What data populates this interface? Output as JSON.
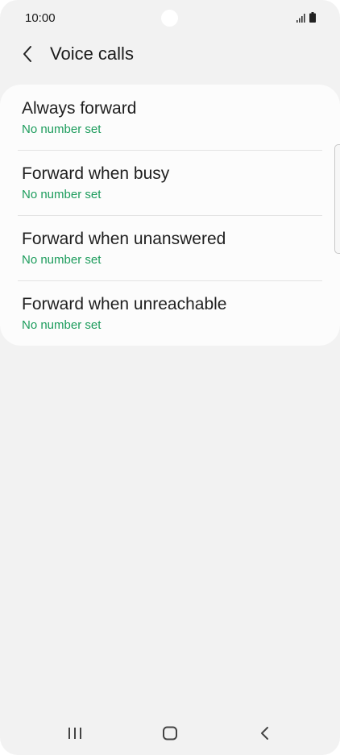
{
  "status_bar": {
    "time": "10:00",
    "icons": [
      "signal-icon",
      "battery-icon"
    ]
  },
  "header": {
    "back_icon": "chevron-left-icon",
    "title": "Voice calls"
  },
  "options": [
    {
      "title": "Always forward",
      "subtitle": "No number set"
    },
    {
      "title": "Forward when busy",
      "subtitle": "No number set"
    },
    {
      "title": "Forward when unanswered",
      "subtitle": "No number set"
    },
    {
      "title": "Forward when unreachable",
      "subtitle": "No number set"
    }
  ],
  "nav_bar": {
    "buttons": [
      "recent-apps-icon",
      "home-icon",
      "back-icon"
    ]
  },
  "colors": {
    "accent": "#1c9c5c",
    "background": "#f2f2f2",
    "card": "#fcfcfc"
  }
}
